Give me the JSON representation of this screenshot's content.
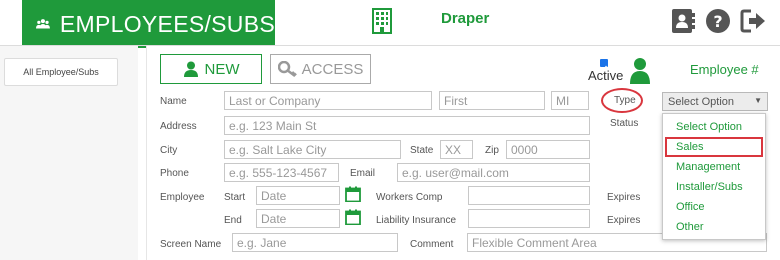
{
  "header": {
    "brand": "EMPLOYEES/SUBS",
    "location": "Draper"
  },
  "sidebar": {
    "items": [
      {
        "label": "All Employee/Subs"
      }
    ]
  },
  "buttons": {
    "new": "NEW",
    "access": "ACCESS"
  },
  "active": {
    "label": "Active",
    "checked": true
  },
  "employee_num_label": "Employee #",
  "form": {
    "name_label": "Name",
    "last_placeholder": "Last or Company",
    "first_placeholder": "First",
    "mi_placeholder": "MI",
    "type_label": "Type",
    "address_label": "Address",
    "address_placeholder": "e.g. 123 Main St",
    "status_label": "Status",
    "city_label": "City",
    "city_placeholder": "e.g. Salt Lake City",
    "state_label": "State",
    "state_placeholder": "XX",
    "zip_label": "Zip",
    "zip_placeholder": "0000",
    "phone_label": "Phone",
    "phone_placeholder": "e.g. 555-123-4567",
    "email_label": "Email",
    "email_placeholder": "e.g. user@mail.com",
    "employee_label": "Employee",
    "start_label": "Start",
    "end_label": "End",
    "date_placeholder": "Date",
    "workers_comp_label": "Workers Comp",
    "liability_label": "Liability Insurance",
    "expires_label": "Expires",
    "screen_name_label": "Screen Name",
    "screen_name_placeholder": "e.g. Jane",
    "comment_label": "Comment",
    "comment_placeholder": "Flexible Comment Area"
  },
  "type_select": {
    "selected": "Select Option",
    "options": [
      "Select Option",
      "Sales",
      "Management",
      "Installer/Subs",
      "Office",
      "Other"
    ]
  },
  "colors": {
    "brand_green": "#1f9a3b",
    "annotation_red": "#d9363e"
  }
}
